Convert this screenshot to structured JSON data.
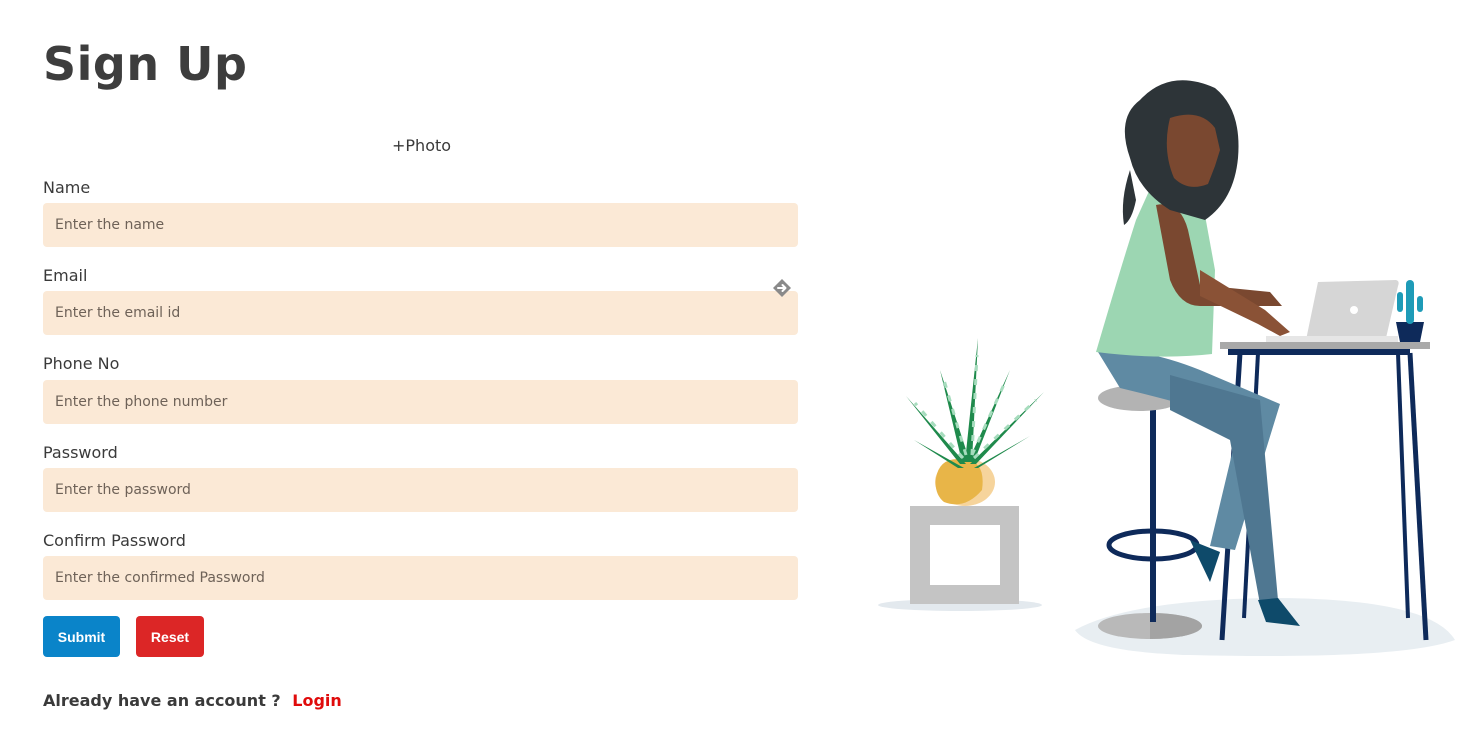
{
  "page": {
    "title": "Sign Up",
    "photo_link": "+Photo"
  },
  "form": {
    "fields": [
      {
        "label": "Name",
        "placeholder": "Enter the name"
      },
      {
        "label": "Email",
        "placeholder": "Enter the email id"
      },
      {
        "label": "Phone No",
        "placeholder": "Enter the phone number"
      },
      {
        "label": "Password",
        "placeholder": "Enter the password"
      },
      {
        "label": "Confirm Password",
        "placeholder": "Enter the confirmed Password"
      }
    ],
    "submit_label": "Submit",
    "reset_label": "Reset"
  },
  "footer": {
    "prompt": "Already have an account ?",
    "login_label": "Login"
  },
  "colors": {
    "input_bg": "#fbe9d6",
    "submit_bg": "#0a84c9",
    "reset_bg": "#dc2626",
    "login_link": "#e00b0b"
  },
  "icons": {
    "autofill": "autofill-key-icon",
    "illustration": "woman-at-laptop-illustration"
  }
}
